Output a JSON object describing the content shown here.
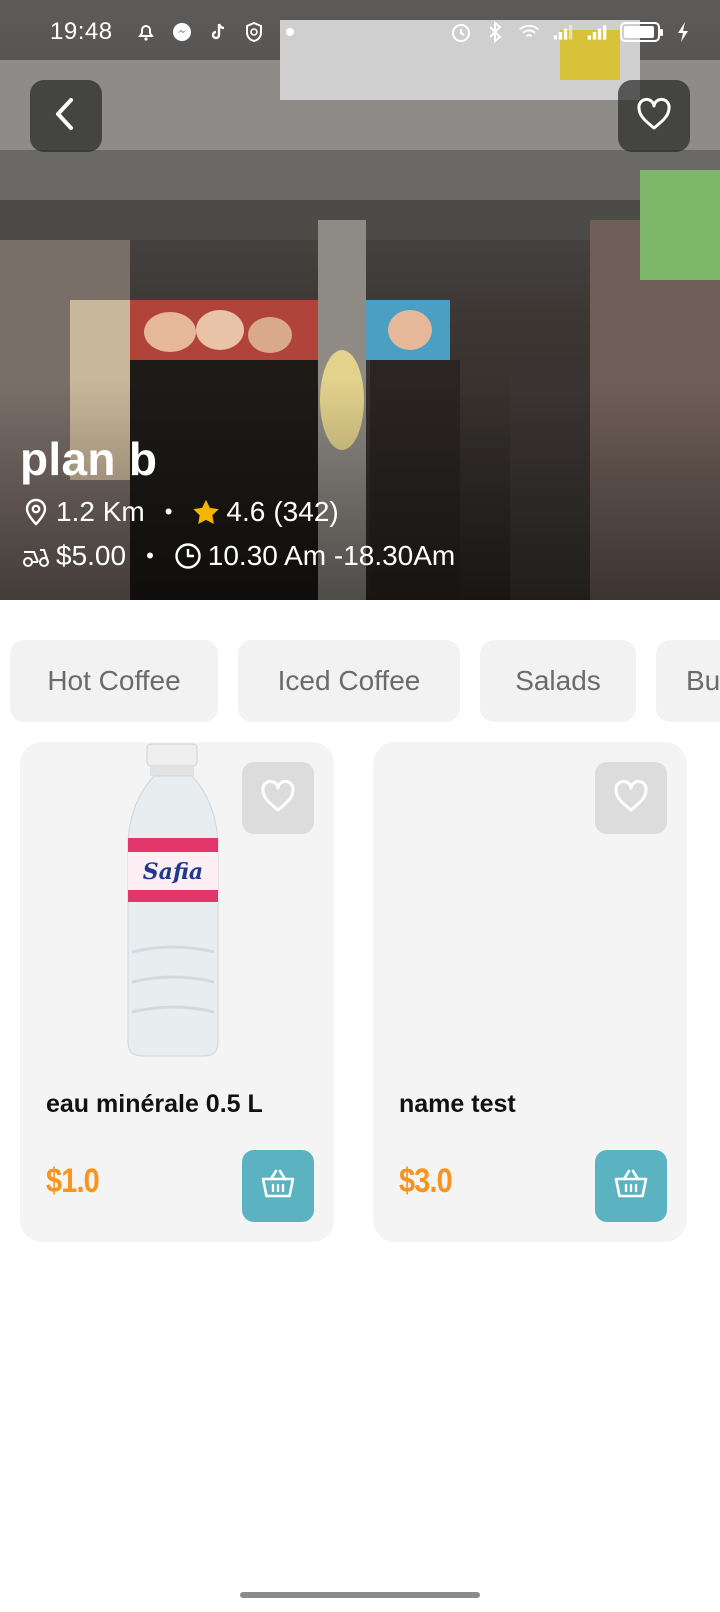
{
  "status_bar": {
    "time": "19:48"
  },
  "store": {
    "name": "plan b",
    "distance": "1.2 Km",
    "rating": "4.6",
    "rating_count": "(342)",
    "delivery_fee": "$5.00",
    "hours": "10.30 Am -18.30Am",
    "separator": "•"
  },
  "categories": [
    {
      "label": "Hot Coffee"
    },
    {
      "label": "Iced Coffee"
    },
    {
      "label": "Salads"
    },
    {
      "label": "Bu"
    }
  ],
  "products": [
    {
      "name": "eau minérale 0.5 L",
      "price": "$1.0",
      "image_label": "Safia"
    },
    {
      "name": "name test",
      "price": "$3.0"
    }
  ],
  "colors": {
    "accent_price": "#f7941d",
    "cart_button": "#5bb3c1",
    "star": "#f5b400"
  }
}
